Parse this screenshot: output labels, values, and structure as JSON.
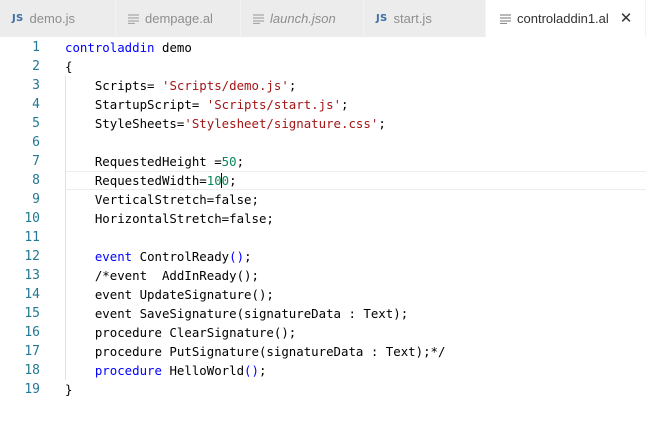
{
  "tabs": [
    {
      "icon": "js-icon",
      "icon_text": "JS",
      "label": "demo.js",
      "italic": false,
      "active": false
    },
    {
      "icon": "lines-file-icon",
      "icon_text": "",
      "label": "dempage.al",
      "italic": false,
      "active": false
    },
    {
      "icon": "lines-file-icon",
      "icon_text": "",
      "label": "launch.json",
      "italic": true,
      "active": false
    },
    {
      "icon": "js-icon",
      "icon_text": "JS",
      "label": "start.js",
      "italic": false,
      "active": false
    },
    {
      "icon": "lines-file-icon",
      "icon_text": "",
      "label": "controladdin1.al",
      "italic": false,
      "active": true,
      "close": "✕"
    }
  ],
  "editor": {
    "current_line": 8,
    "colors": {
      "keyword": "#0000ff",
      "string": "#a31515",
      "number": "#098658",
      "line_number": "#237893"
    },
    "lines": [
      {
        "n": "1",
        "tokens": [
          {
            "t": "kw",
            "v": "controladdin"
          },
          {
            "t": "p",
            "v": " demo"
          }
        ]
      },
      {
        "n": "2",
        "tokens": [
          {
            "t": "p",
            "v": "{"
          }
        ]
      },
      {
        "n": "3",
        "tokens": [
          {
            "t": "p",
            "v": "    Scripts= "
          },
          {
            "t": "str",
            "v": "'Scripts/demo.js'"
          },
          {
            "t": "p",
            "v": ";"
          }
        ]
      },
      {
        "n": "4",
        "tokens": [
          {
            "t": "p",
            "v": "    StartupScript= "
          },
          {
            "t": "str",
            "v": "'Scripts/start.js'"
          },
          {
            "t": "p",
            "v": ";"
          }
        ]
      },
      {
        "n": "5",
        "tokens": [
          {
            "t": "p",
            "v": "    StyleSheets="
          },
          {
            "t": "str",
            "v": "'Stylesheet/signature.css'"
          },
          {
            "t": "p",
            "v": ";"
          }
        ]
      },
      {
        "n": "6",
        "tokens": []
      },
      {
        "n": "7",
        "tokens": [
          {
            "t": "p",
            "v": "    RequestedHeight ="
          },
          {
            "t": "num",
            "v": "50"
          },
          {
            "t": "p",
            "v": ";"
          }
        ]
      },
      {
        "n": "8",
        "tokens": [
          {
            "t": "p",
            "v": "    RequestedWidth="
          },
          {
            "t": "num",
            "v": "10"
          },
          {
            "t": "cursor",
            "v": ""
          },
          {
            "t": "num",
            "v": "0"
          },
          {
            "t": "p",
            "v": ";"
          }
        ]
      },
      {
        "n": "9",
        "tokens": [
          {
            "t": "p",
            "v": "    VerticalStretch=false;"
          }
        ]
      },
      {
        "n": "10",
        "tokens": [
          {
            "t": "p",
            "v": "    HorizontalStretch=false;"
          }
        ]
      },
      {
        "n": "11",
        "tokens": []
      },
      {
        "n": "12",
        "tokens": [
          {
            "t": "p",
            "v": "    "
          },
          {
            "t": "kw",
            "v": "event"
          },
          {
            "t": "p",
            "v": " ControlReady"
          },
          {
            "t": "kw",
            "v": "()"
          },
          {
            "t": "p",
            "v": ";"
          }
        ]
      },
      {
        "n": "13",
        "tokens": [
          {
            "t": "p",
            "v": "    /*event  AddInReady();"
          }
        ]
      },
      {
        "n": "14",
        "tokens": [
          {
            "t": "p",
            "v": "    event UpdateSignature();"
          }
        ]
      },
      {
        "n": "15",
        "tokens": [
          {
            "t": "p",
            "v": "    event SaveSignature(signatureData : Text);"
          }
        ]
      },
      {
        "n": "16",
        "tokens": [
          {
            "t": "p",
            "v": "    procedure ClearSignature();"
          }
        ]
      },
      {
        "n": "17",
        "tokens": [
          {
            "t": "p",
            "v": "    procedure PutSignature(signatureData : Text);*/"
          }
        ]
      },
      {
        "n": "18",
        "tokens": [
          {
            "t": "p",
            "v": "    "
          },
          {
            "t": "kw",
            "v": "procedure"
          },
          {
            "t": "p",
            "v": " HelloWorld"
          },
          {
            "t": "kw",
            "v": "()"
          },
          {
            "t": "p",
            "v": ";"
          }
        ]
      },
      {
        "n": "19",
        "tokens": [
          {
            "t": "p",
            "v": "}"
          }
        ]
      }
    ]
  }
}
